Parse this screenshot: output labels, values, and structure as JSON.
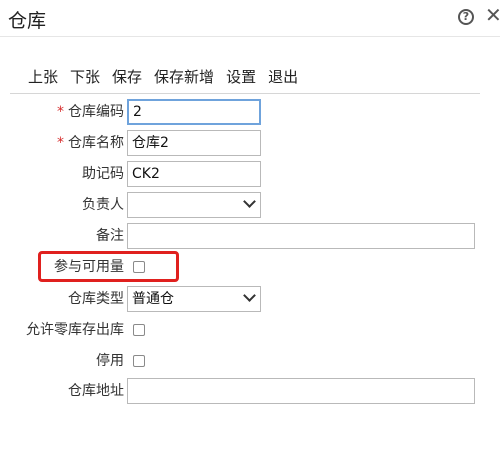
{
  "dialog": {
    "title": "仓库"
  },
  "toolbar": {
    "items": [
      "上张",
      "下张",
      "保存",
      "保存新增",
      "设置",
      "退出"
    ]
  },
  "form": {
    "code": {
      "label": "仓库编码",
      "value": "2"
    },
    "name": {
      "label": "仓库名称",
      "value": "仓库2"
    },
    "mnemonic": {
      "label": "助记码",
      "value": "CK2"
    },
    "manager": {
      "label": "负责人",
      "value": ""
    },
    "remark": {
      "label": "备注",
      "value": ""
    },
    "available_qty": {
      "label": "参与可用量",
      "checked": false
    },
    "warehouse_type": {
      "label": "仓库类型",
      "value": "普通仓"
    },
    "allow_zero_stock_out": {
      "label": "允许零库存出库",
      "checked": false
    },
    "disabled": {
      "label": "停用",
      "checked": false
    },
    "address": {
      "label": "仓库地址",
      "value": ""
    }
  },
  "colors": {
    "required_mark": "#d62c2c",
    "highlight": "#e0201e",
    "focus_border": "#6fa3dc"
  }
}
